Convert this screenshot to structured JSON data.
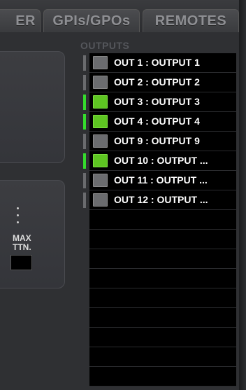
{
  "tabs": [
    {
      "label": "ER"
    },
    {
      "label": "GPIs/GPOs"
    },
    {
      "label": "REMOTES"
    }
  ],
  "left_panel": {
    "max_label": "MAX",
    "attn_label": "TTN."
  },
  "outputs": {
    "title": "OUTPUTS",
    "items": [
      {
        "label": "OUT 1 : OUTPUT 1",
        "active": false
      },
      {
        "label": "OUT 2 : OUTPUT 2",
        "active": false
      },
      {
        "label": "OUT 3 : OUTPUT 3",
        "active": true
      },
      {
        "label": "OUT 4 : OUTPUT 4",
        "active": true
      },
      {
        "label": "OUT 9 : OUTPUT 9",
        "active": false
      },
      {
        "label": "OUT 10 : OUTPUT ...",
        "active": true
      },
      {
        "label": "OUT 11 : OUTPUT ...",
        "active": false
      },
      {
        "label": "OUT 12 : OUTPUT ...",
        "active": false
      }
    ],
    "empty_rows": 9
  },
  "colors": {
    "active_green": "#5ec522",
    "inactive_gray": "#6b6c6f",
    "meter_green": "#35dc2d",
    "background": "#2f3033"
  }
}
